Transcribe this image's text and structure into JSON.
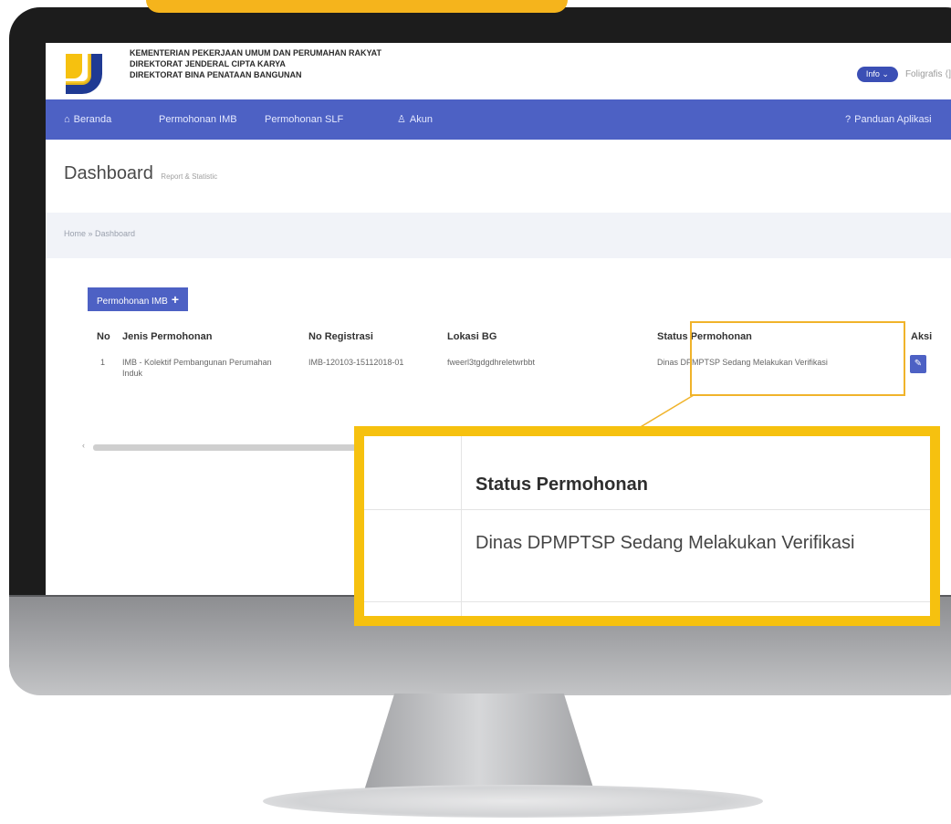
{
  "header": {
    "org_line1": "KEMENTERIAN PEKERJAAN UMUM DAN PERUMAHAN RAKYAT",
    "org_line2": "DIREKTORAT JENDERAL CIPTA KARYA",
    "org_line3": "DIREKTORAT BINA PENATAAN BANGUNAN",
    "info_label": "Info",
    "user_name": "Foligrafis"
  },
  "nav": {
    "beranda": "Beranda",
    "permohonan_imb": "Permohonan IMB",
    "permohonan_slf": "Permohonan SLF",
    "akun": "Akun",
    "panduan": "Panduan Aplikasi"
  },
  "page": {
    "title": "Dashboard",
    "subtitle": "Report & Statistic",
    "breadcrumb": "Home » Dashboard"
  },
  "table": {
    "add_button": "Permohonan IMB",
    "headers": [
      "No",
      "Jenis Permohonan",
      "No Registrasi",
      "Lokasi BG",
      "Status Permohonan",
      "Aksi"
    ],
    "rows": [
      {
        "no": "1",
        "jenis": "IMB - Kolektif Pembangunan Perumahan Induk",
        "no_registrasi": "IMB-120103-15112018-01",
        "lokasi": "fweerl3tgdgdhreletwrbbt",
        "status": "Dinas DPMPTSP Sedang Melakukan Verifikasi",
        "aksi_icon": "edit-icon"
      }
    ]
  },
  "zoom": {
    "header": "Status Permohonan",
    "value": "Dinas DPMPTSP Sedang Melakukan Verifikasi"
  },
  "colors": {
    "nav": "#4d61c4",
    "accent_yellow": "#f6c10f",
    "highlight_border": "#f0b32a"
  }
}
